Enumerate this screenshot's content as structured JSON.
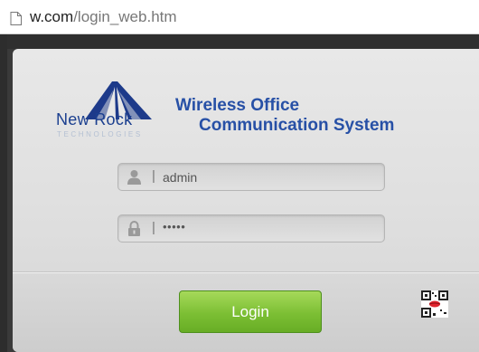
{
  "address_bar": {
    "url_host": "w.com",
    "url_path": "/login_web.htm",
    "page_icon": "page-icon"
  },
  "logo": {
    "brand": "New Rock",
    "tagline": "TECHNOLOGIES",
    "mark_icon": "mountain-logo-icon"
  },
  "system_title": {
    "line1": "Wireless Office",
    "line2": "Communication System"
  },
  "username_field": {
    "icon": "user-icon",
    "separator": "|",
    "value": "admin"
  },
  "password_field": {
    "icon": "lock-icon",
    "separator": "|",
    "value": "•••••"
  },
  "login_button": {
    "label": "Login"
  },
  "qr_code": {
    "icon": "qr-code-icon"
  },
  "colors": {
    "brand_blue": "#2750a6",
    "login_green": "#7cbf34"
  }
}
